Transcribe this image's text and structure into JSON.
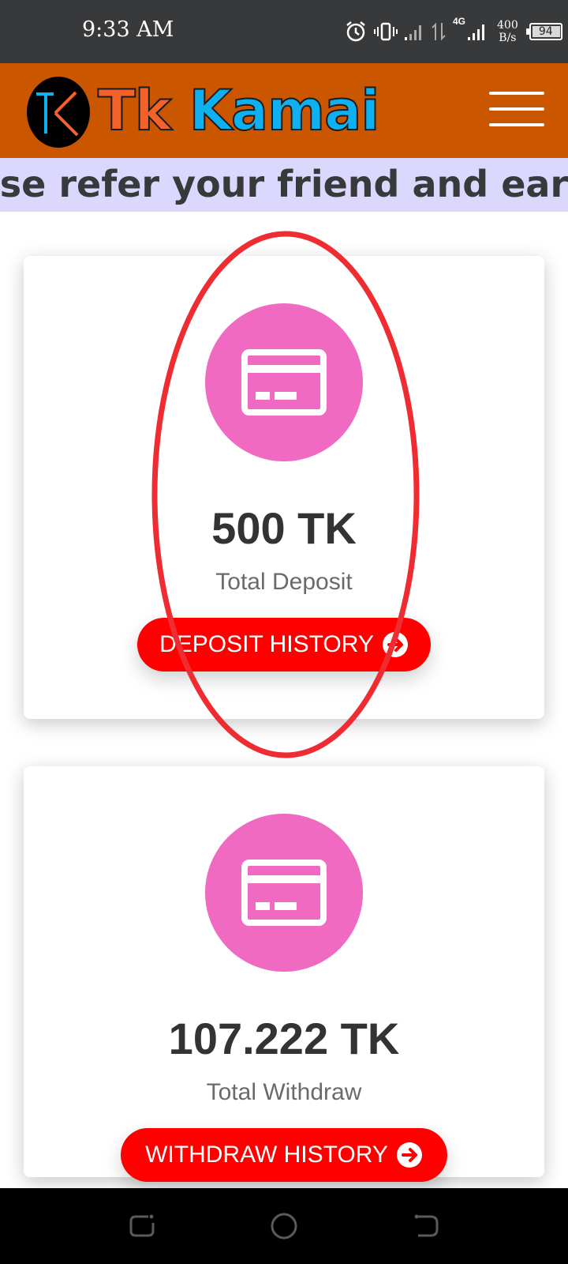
{
  "status_bar": {
    "time": "9:33 AM",
    "network": "4G",
    "net_speed_value": "400",
    "net_speed_unit": "B/s",
    "battery": "94",
    "icons": [
      "alarm-icon",
      "vibrate-icon",
      "signal-icon",
      "data-arrows-icon",
      "signal-4g-icon"
    ]
  },
  "header": {
    "logo_part1": "Tk",
    "logo_part2": "Kamai",
    "colors": {
      "bar": "#cb5600",
      "tk": "#f3622b",
      "kamai": "#0eb0f0"
    }
  },
  "marquee": {
    "text": "Please refer your friend and earn"
  },
  "cards": {
    "deposit": {
      "amount": "500 TK",
      "label": "Total Deposit",
      "button_label": "DEPOSIT HISTORY",
      "icon": "card-icon"
    },
    "withdraw": {
      "amount": "107.222 TK",
      "label": "Total Withdraw",
      "button_label": "WITHDRAW HISTORY",
      "icon": "card-icon"
    }
  },
  "colors": {
    "icon_circle": "#f06ac2",
    "button": "#fe0000",
    "annotation": "#f02c33"
  },
  "nav_bar": {
    "icons": [
      "recents-icon",
      "home-icon",
      "back-icon"
    ]
  }
}
